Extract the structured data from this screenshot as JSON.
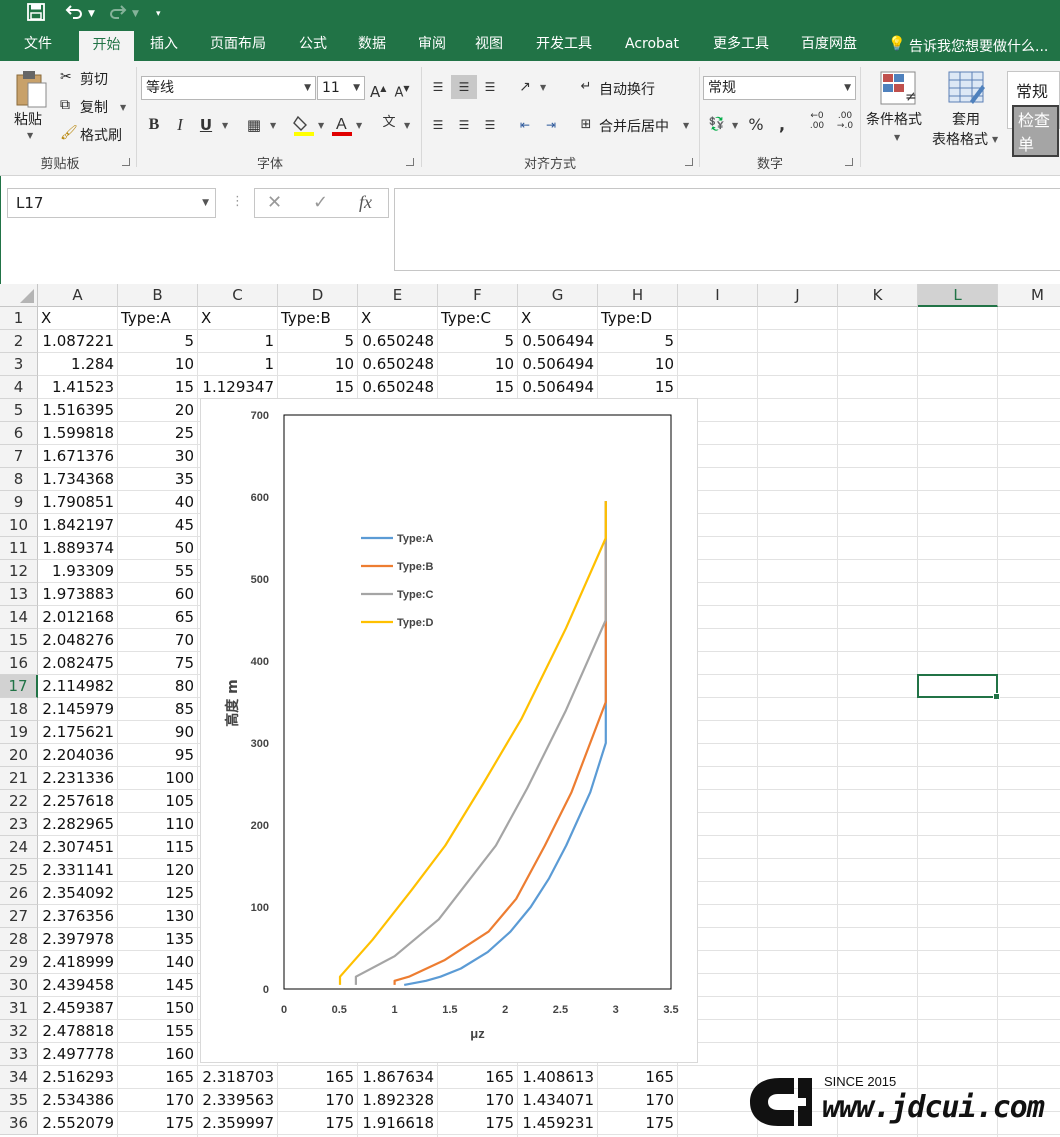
{
  "qat": {
    "save_icon": "save-icon",
    "undo_icon": "undo-icon",
    "redo_icon": "redo-icon"
  },
  "tabs": [
    "文件",
    "开始",
    "插入",
    "页面布局",
    "公式",
    "数据",
    "审阅",
    "视图",
    "开发工具",
    "Acrobat",
    "更多工具",
    "百度网盘"
  ],
  "active_tab": "开始",
  "tell_me": "告诉我您想要做什么...",
  "ribbon": {
    "clipboard": {
      "paste": "粘贴",
      "cut": "剪切",
      "copy": "复制",
      "format_painter": "格式刷",
      "label": "剪贴板"
    },
    "font": {
      "name": "等线",
      "size": "11",
      "label": "字体"
    },
    "alignment": {
      "wrap": "自动换行",
      "merge": "合并后居中",
      "label": "对齐方式"
    },
    "number": {
      "format": "常规",
      "label": "数字"
    },
    "styles": {
      "conditional": "条件格式",
      "table_top": "套用",
      "table_bottom": "表格格式",
      "style1": "常规",
      "style2": "检查单"
    }
  },
  "formula_bar": {
    "name_box": "L17",
    "formula": ""
  },
  "columns": [
    "A",
    "B",
    "C",
    "D",
    "E",
    "F",
    "G",
    "H",
    "I",
    "J",
    "K",
    "L",
    "M"
  ],
  "selected_column": "L",
  "selected_row": 17,
  "rows": [
    {
      "n": 1,
      "cells": [
        "X",
        "Type:A",
        "X",
        "Type:B",
        "X",
        "Type:C",
        "X",
        "Type:D"
      ]
    },
    {
      "n": 2,
      "cells": [
        "1.087221",
        "5",
        "1",
        "5",
        "0.650248",
        "5",
        "0.506494",
        "5"
      ]
    },
    {
      "n": 3,
      "cells": [
        "1.284",
        "10",
        "1",
        "10",
        "0.650248",
        "10",
        "0.506494",
        "10"
      ]
    },
    {
      "n": 4,
      "cells": [
        "1.41523",
        "15",
        "1.129347",
        "15",
        "0.650248",
        "15",
        "0.506494",
        "15"
      ]
    },
    {
      "n": 5,
      "cells": [
        "1.516395",
        "20"
      ]
    },
    {
      "n": 6,
      "cells": [
        "1.599818",
        "25"
      ]
    },
    {
      "n": 7,
      "cells": [
        "1.671376",
        "30"
      ]
    },
    {
      "n": 8,
      "cells": [
        "1.734368",
        "35"
      ]
    },
    {
      "n": 9,
      "cells": [
        "1.790851",
        "40"
      ]
    },
    {
      "n": 10,
      "cells": [
        "1.842197",
        "45"
      ]
    },
    {
      "n": 11,
      "cells": [
        "1.889374",
        "50"
      ]
    },
    {
      "n": 12,
      "cells": [
        "1.93309",
        "55"
      ]
    },
    {
      "n": 13,
      "cells": [
        "1.973883",
        "60"
      ]
    },
    {
      "n": 14,
      "cells": [
        "2.012168",
        "65"
      ]
    },
    {
      "n": 15,
      "cells": [
        "2.048276",
        "70"
      ]
    },
    {
      "n": 16,
      "cells": [
        "2.082475",
        "75"
      ]
    },
    {
      "n": 17,
      "cells": [
        "2.114982",
        "80"
      ]
    },
    {
      "n": 18,
      "cells": [
        "2.145979",
        "85"
      ]
    },
    {
      "n": 19,
      "cells": [
        "2.175621",
        "90"
      ]
    },
    {
      "n": 20,
      "cells": [
        "2.204036",
        "95"
      ]
    },
    {
      "n": 21,
      "cells": [
        "2.231336",
        "100"
      ]
    },
    {
      "n": 22,
      "cells": [
        "2.257618",
        "105"
      ]
    },
    {
      "n": 23,
      "cells": [
        "2.282965",
        "110"
      ]
    },
    {
      "n": 24,
      "cells": [
        "2.307451",
        "115"
      ]
    },
    {
      "n": 25,
      "cells": [
        "2.331141",
        "120"
      ]
    },
    {
      "n": 26,
      "cells": [
        "2.354092",
        "125"
      ]
    },
    {
      "n": 27,
      "cells": [
        "2.376356",
        "130"
      ]
    },
    {
      "n": 28,
      "cells": [
        "2.397978",
        "135"
      ]
    },
    {
      "n": 29,
      "cells": [
        "2.418999",
        "140"
      ]
    },
    {
      "n": 30,
      "cells": [
        "2.439458",
        "145"
      ]
    },
    {
      "n": 31,
      "cells": [
        "2.459387",
        "150"
      ]
    },
    {
      "n": 32,
      "cells": [
        "2.478818",
        "155"
      ]
    },
    {
      "n": 33,
      "cells": [
        "2.497778",
        "160"
      ]
    },
    {
      "n": 34,
      "cells": [
        "2.516293",
        "165",
        "2.318703",
        "165",
        "1.867634",
        "165",
        "1.408613",
        "165"
      ]
    },
    {
      "n": 35,
      "cells": [
        "2.534386",
        "170",
        "2.339563",
        "170",
        "1.892328",
        "170",
        "1.434071",
        "170"
      ]
    },
    {
      "n": 36,
      "cells": [
        "2.552079",
        "175",
        "2.359997",
        "175",
        "1.916618",
        "175",
        "1.459231",
        "175"
      ]
    }
  ],
  "chart_data": {
    "type": "line",
    "title": "",
    "xlabel": "μz",
    "ylabel": "高度 m",
    "xlim": [
      0,
      3.5
    ],
    "ylim": [
      0,
      700
    ],
    "xticks": [
      "0",
      "0.5",
      "1",
      "1.5",
      "2",
      "2.5",
      "3",
      "3.5"
    ],
    "yticks": [
      "0",
      "100",
      "200",
      "300",
      "400",
      "500",
      "600",
      "700"
    ],
    "grid": false,
    "legend": "upper-left-inside",
    "series": [
      {
        "name": "Type:A",
        "color": "#5b9bd5",
        "x": [
          1.087221,
          1.284,
          1.41523,
          1.599818,
          1.842197,
          2.048276,
          2.231336,
          2.397978,
          2.552079,
          2.77,
          2.91,
          2.91
        ],
        "y": [
          5,
          10,
          15,
          25,
          45,
          70,
          100,
          135,
          175,
          240,
          300,
          595
        ]
      },
      {
        "name": "Type:B",
        "color": "#ed7d31",
        "x": [
          1,
          1,
          1.129347,
          1.45,
          1.85,
          2.1,
          2.359997,
          2.6,
          2.91,
          2.91
        ],
        "y": [
          5,
          10,
          15,
          35,
          70,
          110,
          175,
          240,
          350,
          595
        ]
      },
      {
        "name": "Type:C",
        "color": "#a5a5a5",
        "x": [
          0.650248,
          0.650248,
          0.650248,
          1.0,
          1.4,
          1.916618,
          2.2,
          2.55,
          2.91,
          2.91
        ],
        "y": [
          5,
          10,
          15,
          40,
          85,
          175,
          245,
          340,
          450,
          595
        ]
      },
      {
        "name": "Type:D",
        "color": "#ffc000",
        "x": [
          0.506494,
          0.506494,
          0.506494,
          0.8,
          1.15,
          1.459231,
          1.8,
          2.15,
          2.55,
          2.91,
          2.91
        ],
        "y": [
          5,
          10,
          15,
          60,
          120,
          175,
          250,
          330,
          440,
          550,
          595
        ]
      }
    ]
  },
  "watermark": {
    "since": "SINCE 2015",
    "url": "www.jdcui.com"
  }
}
